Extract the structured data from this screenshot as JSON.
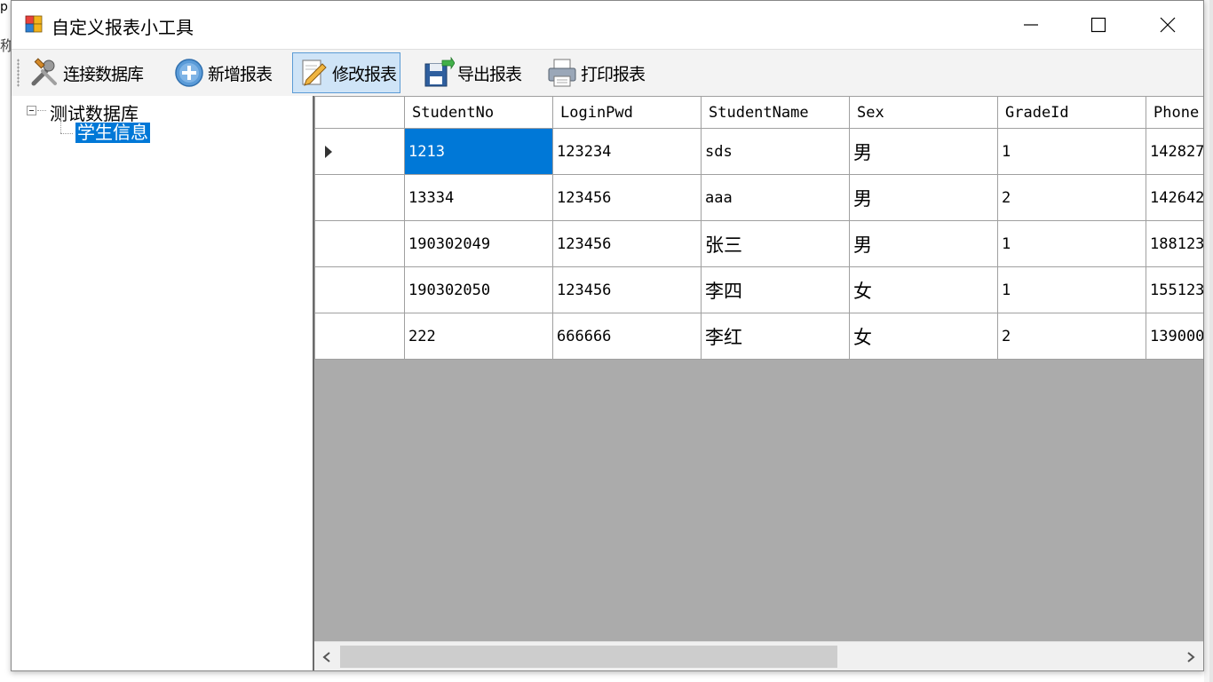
{
  "background_fragments": {
    "top_left": "p",
    "left": "称"
  },
  "window": {
    "title": "自定义报表小工具",
    "controls": {
      "minimize": "minimize",
      "maximize": "maximize",
      "close": "close"
    }
  },
  "toolbar": {
    "connect_label": "连接数据库",
    "add_label": "新增报表",
    "edit_label": "修改报表",
    "export_label": "导出报表",
    "print_label": "打印报表",
    "pressed": "edit"
  },
  "tree": {
    "root_label": "测试数据库",
    "child_label": "学生信息",
    "selected": "学生信息"
  },
  "grid": {
    "columns": [
      "StudentNo",
      "LoginPwd",
      "StudentName",
      "Sex",
      "GradeId",
      "Phone"
    ],
    "rows": [
      [
        "1213",
        "123234",
        "sds",
        "男",
        "1",
        "142827"
      ],
      [
        "13334",
        "123456",
        "aaa",
        "男",
        "2",
        "142642"
      ],
      [
        "190302049",
        "123456",
        "张三",
        "男",
        "1",
        "188123"
      ],
      [
        "190302050",
        "123456",
        "李四",
        "女",
        "1",
        "155123"
      ],
      [
        "222",
        "666666",
        "李红",
        "女",
        "2",
        "139000"
      ]
    ],
    "current_row": 0,
    "selected_cell": "1213"
  },
  "colors": {
    "selection": "#0078d7",
    "grid_background": "#ababab",
    "pressed_button": "#cfe4f7"
  }
}
